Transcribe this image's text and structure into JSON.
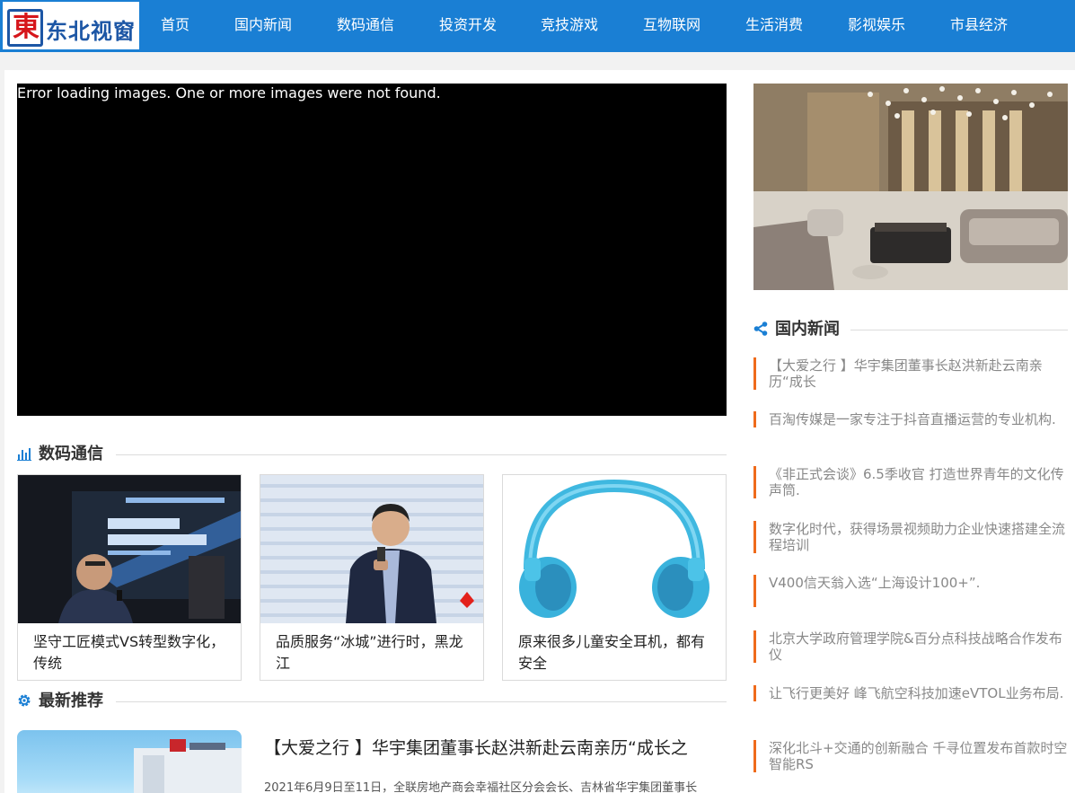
{
  "logo": {
    "char": "東",
    "text": "东北视窗"
  },
  "nav": [
    {
      "label": "首页"
    },
    {
      "label": "国内新闻"
    },
    {
      "label": "数码通信"
    },
    {
      "label": "投资开发"
    },
    {
      "label": "竞技游戏"
    },
    {
      "label": "互物联网"
    },
    {
      "label": "生活消费"
    },
    {
      "label": "影视娱乐"
    },
    {
      "label": "市县经济"
    }
  ],
  "slider": {
    "error": "Error loading images. One or more images were not found."
  },
  "sections": {
    "digital": {
      "title": "数码通信"
    },
    "recommend": {
      "title": "最新推荐"
    }
  },
  "cards": [
    {
      "caption": "坚守工匠模式VS转型数字化，传统"
    },
    {
      "caption": "品质服务“冰城”进行时，黑龙江"
    },
    {
      "caption": "原来很多儿童安全耳机，都有安全"
    }
  ],
  "recommend": {
    "title": "【大爱之行 】华宇集团董事长赵洪新赴云南亲历“成长之",
    "desc": "2021年6月9日至11日，全联房地产商会幸福社区分会会长、吉林省华宇集团董事长"
  },
  "sidebar": {
    "title": "国内新闻",
    "items": [
      {
        "text": "【大爱之行 】华宇集团董事长赵洪新赴云南亲历“成长"
      },
      {
        "text": "百淘传媒是一家专注于抖音直播运营的专业机构."
      },
      {
        "text": "《非正式会谈》6.5季收官 打造世界青年的文化传声筒."
      },
      {
        "text": "数字化时代，获得场景视频助力企业快速搭建全流程培训"
      },
      {
        "text": "V400信天翁入选“上海设计100+”."
      },
      {
        "text": "北京大学政府管理学院&百分点科技战略合作发布仪"
      },
      {
        "text": "让飞行更美好 峰飞航空科技加速eVTOL业务布局."
      },
      {
        "text": "深化北斗+交通的创新融合 千寻位置发布首款时空智能RS"
      }
    ]
  },
  "colors": {
    "nav_bg": "#1a7fd4",
    "accent": "#ef6b1c",
    "icon_blue": "#1a7fd4"
  }
}
